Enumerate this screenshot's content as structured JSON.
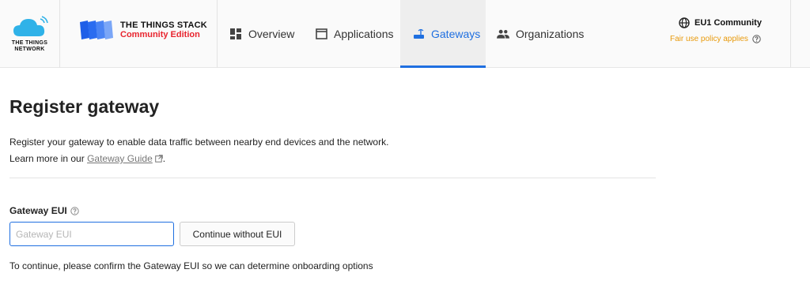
{
  "brand": {
    "ttn_logo_text_line1": "THE THINGS",
    "ttn_logo_text_line2": "NETWORK",
    "stack_title": "THE THINGS STACK",
    "stack_subtitle": "Community Edition",
    "colors": {
      "cloud": "#2fb2e8",
      "stack_blue": "#1f5fe8",
      "edition_red": "#e8242e"
    }
  },
  "nav": {
    "items": [
      {
        "label": "Overview",
        "icon": "dashboard-icon",
        "active": false
      },
      {
        "label": "Applications",
        "icon": "window-icon",
        "active": false
      },
      {
        "label": "Gateways",
        "icon": "router-icon",
        "active": true
      },
      {
        "label": "Organizations",
        "icon": "people-icon",
        "active": false
      }
    ],
    "accent": "#1f6fe0"
  },
  "region": {
    "name": "EU1 Community",
    "note": "Fair use policy applies",
    "note_color": "#e89a0c"
  },
  "main": {
    "title": "Register gateway",
    "description_line1": "Register your gateway to enable data traffic between nearby end devices and the network.",
    "description_line2_prefix": "Learn more in our",
    "guide_link": "Gateway Guide",
    "description_line2_suffix": ".",
    "field_label": "Gateway EUI",
    "eui_placeholder": "Gateway EUI",
    "eui_value": "",
    "continue_button": "Continue without EUI",
    "hint": "To continue, please confirm the Gateway EUI so we can determine onboarding options"
  }
}
